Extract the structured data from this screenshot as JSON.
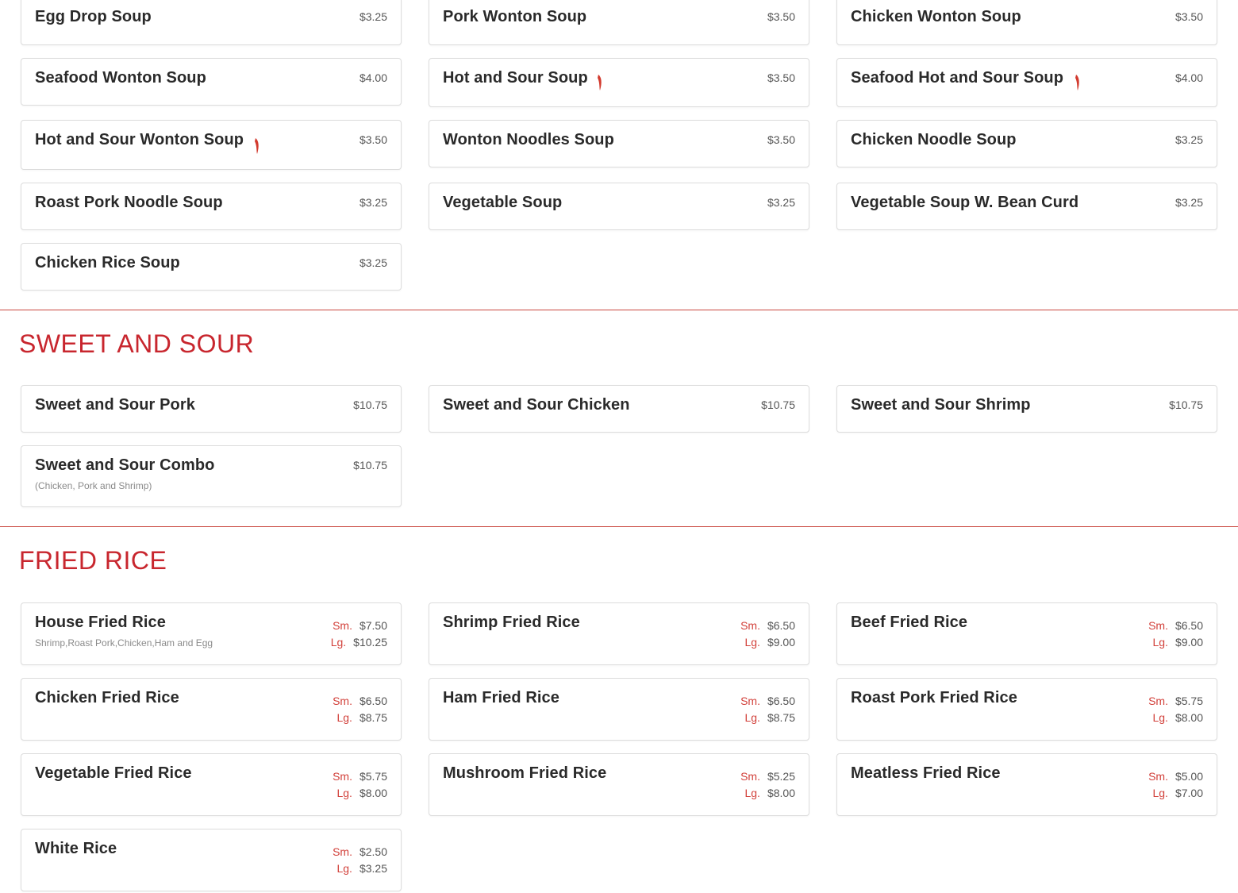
{
  "soups": [
    {
      "name": "Egg Drop Soup",
      "price": "$3.25",
      "spicy": false
    },
    {
      "name": "Pork Wonton Soup",
      "price": "$3.50",
      "spicy": false
    },
    {
      "name": "Chicken Wonton Soup",
      "price": "$3.50",
      "spicy": false
    },
    {
      "name": "Seafood Wonton Soup",
      "price": "$4.00",
      "spicy": false
    },
    {
      "name": "Hot and Sour Soup",
      "price": "$3.50",
      "spicy": true
    },
    {
      "name": "Seafood Hot and Sour Soup",
      "price": "$4.00",
      "spicy": true
    },
    {
      "name": "Hot and Sour Wonton Soup",
      "price": "$3.50",
      "spicy": true
    },
    {
      "name": "Wonton Noodles Soup",
      "price": "$3.50",
      "spicy": false
    },
    {
      "name": "Chicken Noodle Soup",
      "price": "$3.25",
      "spicy": false
    },
    {
      "name": "Roast Pork Noodle Soup",
      "price": "$3.25",
      "spicy": false
    },
    {
      "name": "Vegetable Soup",
      "price": "$3.25",
      "spicy": false
    },
    {
      "name": "Vegetable Soup W. Bean Curd",
      "price": "$3.25",
      "spicy": false
    },
    {
      "name": "Chicken Rice Soup",
      "price": "$3.25",
      "spicy": false
    }
  ],
  "sweet_sour": {
    "title": "SWEET AND SOUR",
    "items": [
      {
        "name": "Sweet and Sour Pork",
        "price": "$10.75"
      },
      {
        "name": "Sweet and Sour Chicken",
        "price": "$10.75"
      },
      {
        "name": "Sweet and Sour Shrimp",
        "price": "$10.75"
      },
      {
        "name": "Sweet and Sour Combo",
        "price": "$10.75",
        "desc": "(Chicken, Pork and Shrimp)"
      }
    ]
  },
  "fried_rice": {
    "title": "FRIED RICE",
    "sm_label": "Sm.",
    "lg_label": "Lg.",
    "items": [
      {
        "name": "House Fried Rice",
        "desc": "Shrimp,Roast Pork,Chicken,Ham and Egg",
        "sm": "$7.50",
        "lg": "$10.25"
      },
      {
        "name": "Shrimp Fried Rice",
        "sm": "$6.50",
        "lg": "$9.00"
      },
      {
        "name": "Beef Fried Rice",
        "sm": "$6.50",
        "lg": "$9.00"
      },
      {
        "name": "Chicken Fried Rice",
        "sm": "$6.50",
        "lg": "$8.75"
      },
      {
        "name": "Ham Fried Rice",
        "sm": "$6.50",
        "lg": "$8.75"
      },
      {
        "name": "Roast Pork Fried Rice",
        "sm": "$5.75",
        "lg": "$8.00"
      },
      {
        "name": "Vegetable Fried Rice",
        "sm": "$5.75",
        "lg": "$8.00"
      },
      {
        "name": "Mushroom Fried Rice",
        "sm": "$5.25",
        "lg": "$8.00"
      },
      {
        "name": "Meatless Fried Rice",
        "sm": "$5.00",
        "lg": "$7.00"
      },
      {
        "name": "White Rice",
        "sm": "$2.50",
        "lg": "$3.25"
      }
    ]
  },
  "colors": {
    "accent": "#c8262e",
    "chili": "#d23a2e",
    "price": "#555555"
  },
  "icons": {
    "spicy": "chili-pepper-icon"
  }
}
